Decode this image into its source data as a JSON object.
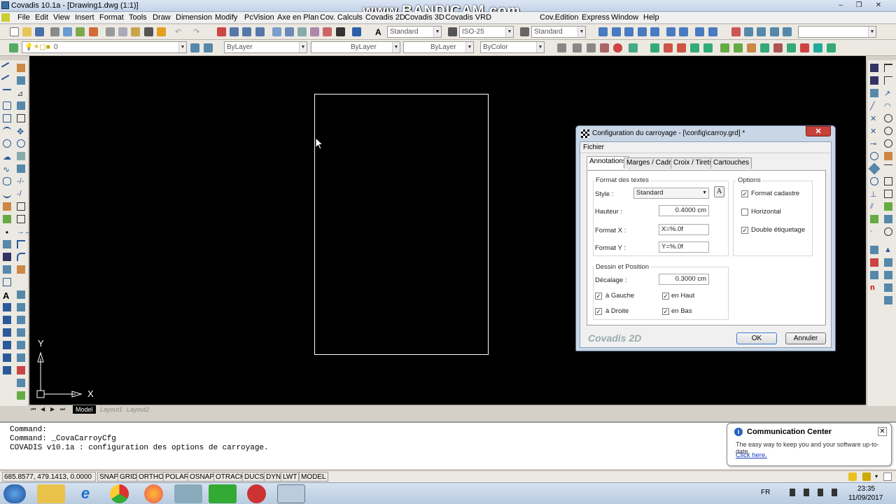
{
  "window": {
    "title": "Covadis 10.1a - [Drawing1.dwg (1:1)]",
    "watermark": "www.BANDICAM.com"
  },
  "menu": [
    "File",
    "Edit",
    "View",
    "Insert",
    "Format",
    "Tools",
    "Draw",
    "Dimension",
    "Modify",
    "PcVision",
    "Axe en Plan",
    "Cov. Calculs",
    "Covadis 2D",
    "Covadis 3D",
    "Covadis VRD",
    "Cov.Edition",
    "Express",
    "Window",
    "Help"
  ],
  "toolbar1": {
    "text_style": "Standard",
    "dim_style": "ISO-25",
    "table_style": "Standard"
  },
  "toolbar2": {
    "layer": "0",
    "color": "ByLayer",
    "linetype": "ByLayer",
    "lineweight": "ByLayer",
    "plotstyle": "ByColor"
  },
  "ucs": {
    "x_label": "X",
    "y_label": "Y"
  },
  "layout_tabs": [
    "Model",
    "Layout1",
    "Layout2"
  ],
  "command_lines": [
    "Command:",
    "Command: _CovaCarroyCfg",
    "COVADIS v10.1a : configuration des options de carroyage."
  ],
  "status": {
    "coords": "685.8577, 479.1413, 0.0000",
    "buttons": [
      "SNAP",
      "GRID",
      "ORTHO",
      "POLAR",
      "OSNAP",
      "OTRACK",
      "DUCS",
      "DYN",
      "LWT",
      "MODEL"
    ]
  },
  "dialog": {
    "title": "Configuration  du carroyage - [\\config\\carroy.grd] *",
    "menu": "Fichier",
    "tabs": [
      "Annotations",
      "Marges / Cadre",
      "Croix / Tirets",
      "Cartouches"
    ],
    "format_group": "Format des textes",
    "style_label": "Style :",
    "style_value": "Standard",
    "hauteur_label": "Hauteur :",
    "hauteur_value": "0.4000 cm",
    "formatx_label": "Format X :",
    "formatx_value": "X=%.0f",
    "formaty_label": "Format Y :",
    "formaty_value": "Y=%.0f",
    "options_group": "Options",
    "opt_cadastre": "Format cadastre",
    "opt_horizontal": "Horizontal",
    "opt_double": "Double étiquetage",
    "dessin_group": "Dessin et Position",
    "decalage_label": "Décalage :",
    "decalage_value": "0.3000 cm",
    "cb_gauche": "à Gauche",
    "cb_droite": "à Droite",
    "cb_haut": "en Haut",
    "cb_bas": "en Bas",
    "brand": "Covadis 2D",
    "ok": "OK",
    "cancel": "Annuler",
    "check_mark": "✓"
  },
  "comm_center": {
    "title": "Communication Center",
    "text": "The easy way to keep you and your software up-to-date.",
    "link": "Click here."
  },
  "taskbar": {
    "lang": "FR",
    "time": "23:35",
    "date": "11/09/2017"
  }
}
